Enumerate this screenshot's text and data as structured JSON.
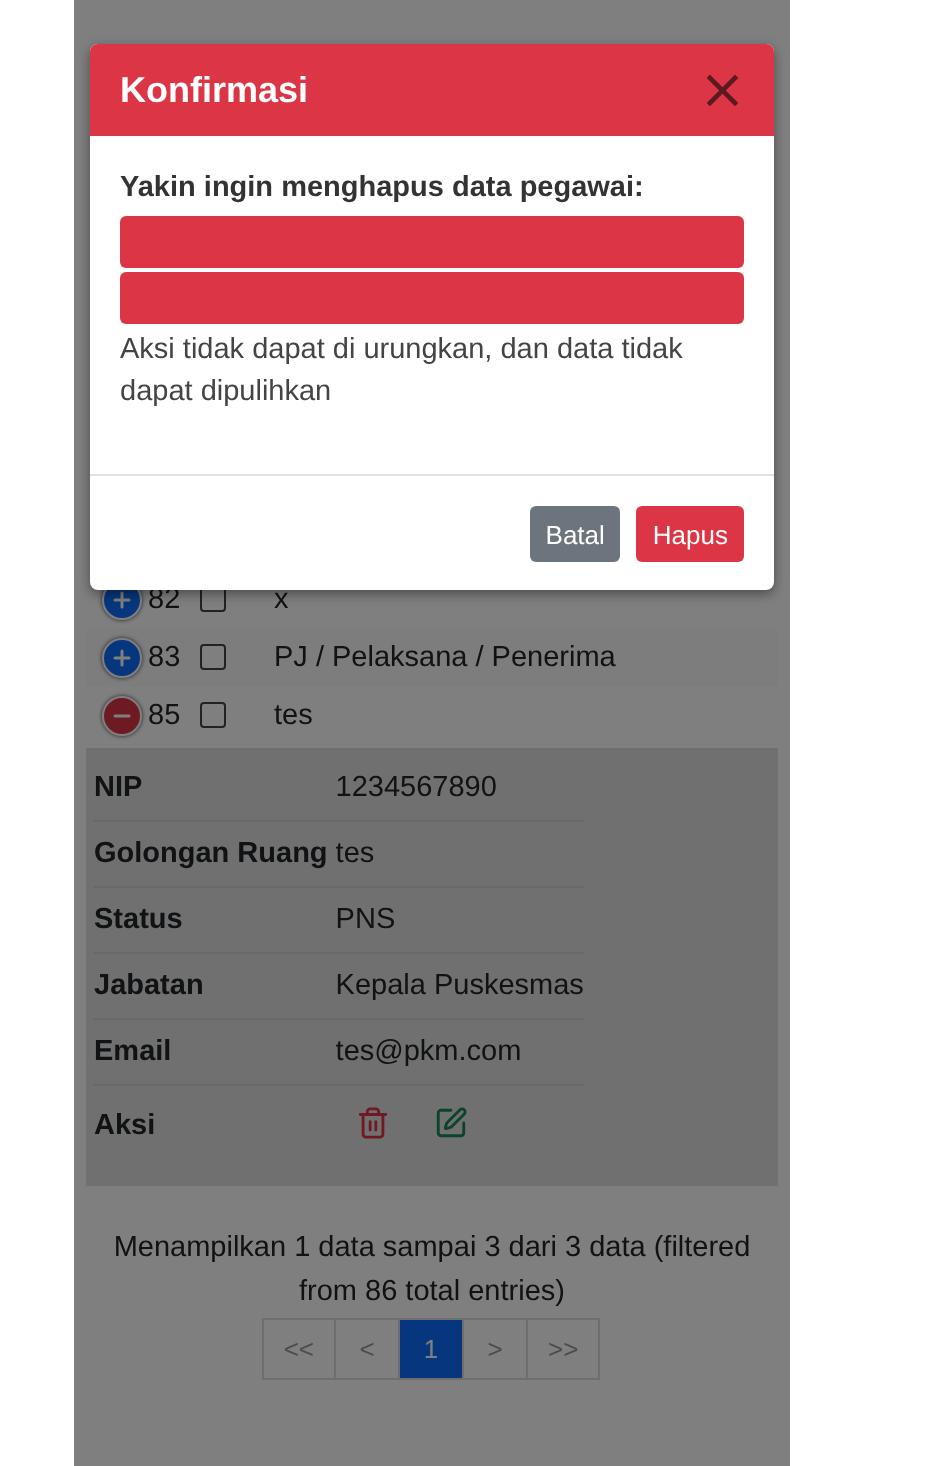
{
  "rows": [
    {
      "number": "82",
      "name": "x",
      "expanded": false,
      "checked": false
    },
    {
      "number": "83",
      "name": "PJ / Pelaksana / Penerima",
      "expanded": false,
      "checked": false
    },
    {
      "number": "85",
      "name": "tes",
      "expanded": true,
      "checked": false
    }
  ],
  "details": [
    {
      "label": "NIP",
      "value": "1234567890"
    },
    {
      "label": "Golongan Ruang",
      "value": "tes"
    },
    {
      "label": "Status",
      "value": "PNS"
    },
    {
      "label": "Jabatan",
      "value": "Kepala Puskesmas"
    },
    {
      "label": "Email",
      "value": "tes@pkm.com"
    }
  ],
  "actions_label": "Aksi",
  "footer_info": "Menampilkan 1 data sampai 3 dari 3 data (filtered from 86 total entries)",
  "pagination": [
    {
      "label": "<<",
      "selected": false
    },
    {
      "label": "<",
      "selected": false
    },
    {
      "label": "1",
      "selected": true
    },
    {
      "label": ">",
      "selected": false
    },
    {
      "label": ">>",
      "selected": false
    }
  ],
  "modal": {
    "title": "Konfirmasi",
    "close": "×",
    "question": "Yakin ingin menghapus data pegawai:",
    "warning": "Aksi tidak dapat di urungkan, dan data tidak dapat dipulihkan",
    "buttons": [
      {
        "kind": "secondary",
        "label": "Batal"
      },
      {
        "kind": "danger",
        "label": "Hapus"
      }
    ]
  }
}
